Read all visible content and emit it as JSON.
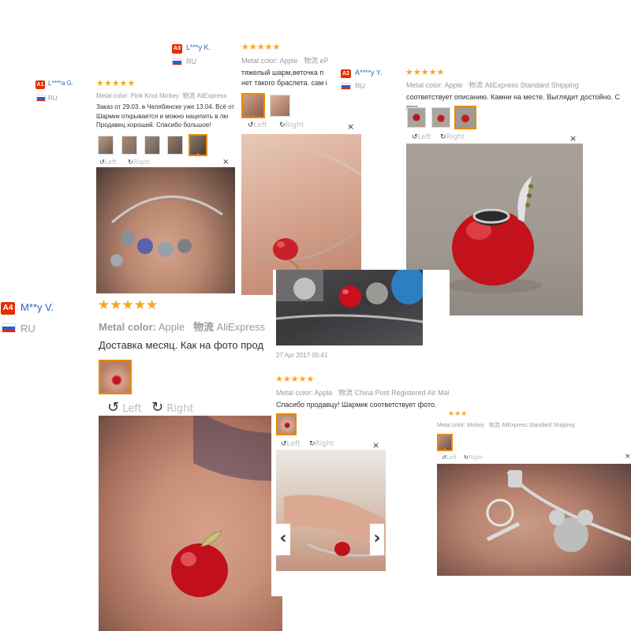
{
  "colors": {
    "accent": "#e62e04",
    "star": "#f5a623",
    "username": "#2e64b8",
    "selected_thumb": "#e88a00"
  },
  "controls": {
    "left": "Left",
    "right": "Right",
    "close": "×",
    "rotate_left_icon": "↺",
    "rotate_right_icon": "↻",
    "prev_icon": "‹",
    "next_icon": "›"
  },
  "reviewers": {
    "a1": {
      "badge": "A1",
      "name": "L****a G.",
      "country": "RU"
    },
    "a3": {
      "badge": "A3",
      "name": "L***y K.",
      "country": "RU"
    },
    "a2": {
      "badge": "A2",
      "name": "A****y Y.",
      "country": "RU"
    },
    "a4": {
      "badge": "A4",
      "name": "M**y V.",
      "country": "RU"
    }
  },
  "reviews": {
    "r1": {
      "stars": "★★★★★",
      "metal_label": "Metal color:",
      "metal_value": "Pink Knot Mickey",
      "shipping_label": "物流",
      "shipping_value": "AliExpress",
      "lines": [
        "Заказ от 29.03. в Челябинске уже 13.04. Всё от",
        "Шармик открывается и можно нацепить в лю",
        "Продавец хороший. Спасибо большое!"
      ]
    },
    "r2": {
      "stars": "★★★★★",
      "metal_label": "Metal color:",
      "metal_value": "Apple",
      "shipping_label": "物流",
      "shipping_value": "eP",
      "lines": [
        "тяжелый шарм,веточка п",
        "нет такого браслета. сам i"
      ]
    },
    "r3": {
      "stars": "★★★★★",
      "metal_label": "Metal color:",
      "metal_value": "Apple",
      "shipping_label": "物流",
      "shipping_value": "AliExpress Standard Shipping",
      "lines": [
        "соответствует описанию. Камни на месте. Выглядит достойно. С про"
      ]
    },
    "r4": {
      "stars": "★★★★★",
      "metal_label": "Metal color:",
      "metal_value": "Apple",
      "shipping_label": "物流",
      "shipping_value": "AliExpress",
      "lines": [
        "Доставка месяц. Как на фото прод"
      ]
    },
    "r5": {
      "date": "27 Apr 2017 05:41",
      "stars": "★★★★★",
      "metal_label": "Metal color:",
      "metal_value": "Apple",
      "shipping_label": "物流",
      "shipping_value": "China Post Registered Air Mail",
      "lines": [
        "Спасибо продавцу! Шармик соответствует фото."
      ]
    },
    "r6": {
      "stars": "★★★",
      "metal_label": "Metal color:",
      "metal_value": "Mickey",
      "shipping_label": "物流",
      "shipping_value": "AliExpress Standard Shipping"
    }
  }
}
